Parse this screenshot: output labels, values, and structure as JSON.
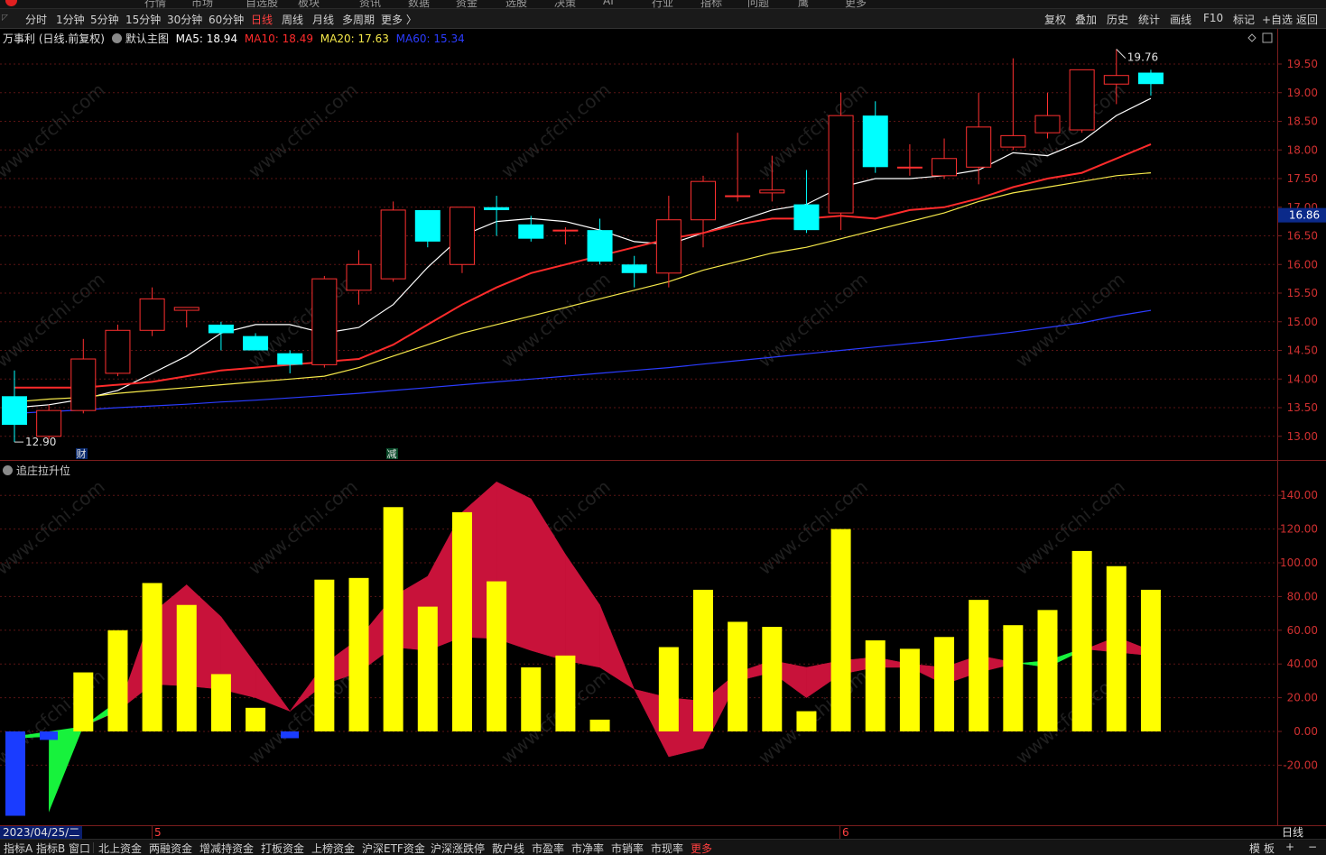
{
  "topstrip": {
    "items": [
      "行情",
      "市场",
      "自选股",
      "板块",
      "资讯",
      "数据",
      "资金",
      "选股",
      "决策",
      "AI",
      "行业",
      "指标",
      "问题",
      "鹰",
      "更多"
    ]
  },
  "periodbar": {
    "periods": [
      "分时",
      "1分钟",
      "5分钟",
      "15分钟",
      "30分钟",
      "60分钟",
      "日线",
      "周线",
      "月线",
      "多周期",
      "更多 〉"
    ],
    "active": "日线",
    "right": [
      "复权",
      "叠加",
      "历史",
      "统计",
      "画线",
      "F10",
      "标记",
      "+自选",
      "返回"
    ]
  },
  "main": {
    "stock": "万事利 (日线.前复权)",
    "template": "默认主图",
    "ma": [
      {
        "label": "MA5: 18.94",
        "color": "#ffffff"
      },
      {
        "label": "MA10: 18.49",
        "color": "#ff2b2b"
      },
      {
        "label": "MA20: 17.63",
        "color": "#f5e84a"
      },
      {
        "label": "MA60: 15.34",
        "color": "#2b3cff"
      }
    ],
    "high_label": "19.76",
    "low_label": "12.90",
    "current_price": "16.86",
    "markers": [
      "财",
      "减"
    ],
    "y_ticks": [
      "19.50",
      "19.00",
      "18.50",
      "18.00",
      "17.50",
      "17.00",
      "16.50",
      "16.00",
      "15.50",
      "15.00",
      "14.50",
      "14.00",
      "13.50",
      "13.00"
    ]
  },
  "sub": {
    "title": "追庄拉升位",
    "y_ticks": [
      "140.00",
      "120.00",
      "100.00",
      "80.00",
      "60.00",
      "40.00",
      "20.00",
      "0.00",
      "-20.00"
    ]
  },
  "datebar": {
    "date": "2023/04/25/二",
    "month_marks": [
      "5",
      "6"
    ],
    "period": "日线"
  },
  "bottom_tabs": [
    "指标A",
    "指标B",
    "窗口",
    "北上资金",
    "两融资金",
    "增减持资金",
    "打板资金",
    "上榜资金",
    "沪深ETF资金",
    "沪深涨跌停",
    "散户线",
    "市盈率",
    "市净率",
    "市销率",
    "市现率",
    "更多"
  ],
  "bottom_right": [
    "模",
    "板",
    "+",
    "−"
  ],
  "watermark": "www.cfchi.com",
  "colors": {
    "up": "#ff3030",
    "down": "#00ffff",
    "ma5": "#ffffff",
    "ma10": "#ff2b2b",
    "ma20": "#f5e84a",
    "ma60": "#2b3cff",
    "bar": "#ffff00",
    "fill_red": "#c8123a",
    "fill_green": "#17f23c",
    "blue": "#1a3cff"
  },
  "chart_data": [
    {
      "type": "candlestick",
      "title": "万事利 (日线.前复权)",
      "ylim": [
        12.6,
        19.9
      ],
      "candles": [
        {
          "o": 13.7,
          "h": 14.15,
          "l": 12.9,
          "c": 13.2
        },
        {
          "o": 13.0,
          "h": 13.55,
          "l": 12.95,
          "c": 13.45
        },
        {
          "o": 13.45,
          "h": 14.7,
          "l": 13.4,
          "c": 14.35
        },
        {
          "o": 14.1,
          "h": 14.95,
          "l": 14.05,
          "c": 14.85
        },
        {
          "o": 14.85,
          "h": 15.6,
          "l": 14.75,
          "c": 15.4
        },
        {
          "o": 15.2,
          "h": 15.25,
          "l": 14.9,
          "c": 15.25
        },
        {
          "o": 14.95,
          "h": 15.0,
          "l": 14.5,
          "c": 14.8
        },
        {
          "o": 14.75,
          "h": 14.8,
          "l": 14.5,
          "c": 14.5
        },
        {
          "o": 14.45,
          "h": 14.5,
          "l": 14.1,
          "c": 14.25
        },
        {
          "o": 14.25,
          "h": 15.8,
          "l": 14.2,
          "c": 15.75
        },
        {
          "o": 15.55,
          "h": 16.25,
          "l": 15.3,
          "c": 16.0
        },
        {
          "o": 15.75,
          "h": 17.1,
          "l": 15.7,
          "c": 16.95
        },
        {
          "o": 16.95,
          "h": 16.95,
          "l": 16.3,
          "c": 16.4
        },
        {
          "o": 16.0,
          "h": 17.0,
          "l": 15.85,
          "c": 17.0
        },
        {
          "o": 17.0,
          "h": 17.2,
          "l": 16.5,
          "c": 16.95
        },
        {
          "o": 16.7,
          "h": 16.85,
          "l": 16.4,
          "c": 16.45
        },
        {
          "o": 16.6,
          "h": 16.65,
          "l": 16.35,
          "c": 16.6
        },
        {
          "o": 16.6,
          "h": 16.8,
          "l": 16.0,
          "c": 16.05
        },
        {
          "o": 16.0,
          "h": 16.15,
          "l": 15.6,
          "c": 15.85
        },
        {
          "o": 15.85,
          "h": 17.2,
          "l": 15.6,
          "c": 16.78
        },
        {
          "o": 16.78,
          "h": 17.55,
          "l": 16.3,
          "c": 17.45
        },
        {
          "o": 17.2,
          "h": 18.3,
          "l": 17.1,
          "c": 17.2
        },
        {
          "o": 17.25,
          "h": 17.9,
          "l": 17.1,
          "c": 17.3
        },
        {
          "o": 17.05,
          "h": 17.65,
          "l": 16.55,
          "c": 16.6
        },
        {
          "o": 16.9,
          "h": 19.0,
          "l": 16.6,
          "c": 18.6
        },
        {
          "o": 18.6,
          "h": 18.85,
          "l": 17.6,
          "c": 17.7
        },
        {
          "o": 17.7,
          "h": 18.1,
          "l": 17.55,
          "c": 17.7
        },
        {
          "o": 17.55,
          "h": 18.2,
          "l": 17.5,
          "c": 17.85
        },
        {
          "o": 17.7,
          "h": 19.0,
          "l": 17.4,
          "c": 18.4
        },
        {
          "o": 18.05,
          "h": 19.6,
          "l": 18.0,
          "c": 18.25
        },
        {
          "o": 18.3,
          "h": 19.0,
          "l": 18.2,
          "c": 18.6
        },
        {
          "o": 18.35,
          "h": 19.4,
          "l": 18.3,
          "c": 19.4
        },
        {
          "o": 19.15,
          "h": 19.76,
          "l": 18.8,
          "c": 19.3
        },
        {
          "o": 19.35,
          "h": 19.4,
          "l": 18.95,
          "c": 19.15
        }
      ],
      "series": [
        {
          "name": "MA5",
          "values": [
            13.5,
            13.55,
            13.65,
            13.8,
            14.1,
            14.4,
            14.8,
            14.95,
            14.95,
            14.8,
            14.9,
            15.3,
            15.95,
            16.5,
            16.75,
            16.8,
            16.75,
            16.6,
            16.4,
            16.35,
            16.55,
            16.75,
            16.95,
            17.05,
            17.35,
            17.5,
            17.5,
            17.55,
            17.65,
            17.95,
            17.9,
            18.15,
            18.6,
            18.9
          ]
        },
        {
          "name": "MA10",
          "values": [
            13.85,
            13.85,
            13.85,
            13.9,
            13.95,
            14.05,
            14.15,
            14.2,
            14.25,
            14.3,
            14.35,
            14.6,
            14.95,
            15.3,
            15.6,
            15.85,
            16.0,
            16.15,
            16.3,
            16.45,
            16.55,
            16.7,
            16.8,
            16.8,
            16.85,
            16.8,
            16.95,
            17.0,
            17.15,
            17.35,
            17.5,
            17.6,
            17.85,
            18.1
          ]
        },
        {
          "name": "MA20",
          "values": [
            13.6,
            13.65,
            13.68,
            13.75,
            13.8,
            13.85,
            13.9,
            13.95,
            14.0,
            14.05,
            14.2,
            14.4,
            14.6,
            14.8,
            14.95,
            15.1,
            15.25,
            15.4,
            15.55,
            15.7,
            15.9,
            16.05,
            16.2,
            16.3,
            16.45,
            16.6,
            16.75,
            16.9,
            17.1,
            17.25,
            17.35,
            17.45,
            17.55,
            17.6
          ]
        },
        {
          "name": "MA60",
          "values": [
            13.4,
            13.43,
            13.46,
            13.5,
            13.53,
            13.56,
            13.6,
            13.63,
            13.67,
            13.71,
            13.75,
            13.8,
            13.85,
            13.9,
            13.95,
            14.0,
            14.05,
            14.1,
            14.15,
            14.2,
            14.26,
            14.32,
            14.38,
            14.44,
            14.5,
            14.56,
            14.62,
            14.68,
            14.75,
            14.82,
            14.9,
            14.98,
            15.1,
            15.2
          ]
        }
      ]
    },
    {
      "type": "bar",
      "title": "追庄拉升位",
      "ylim": [
        -30,
        150
      ],
      "bars": [
        -30,
        -3,
        35,
        60,
        88,
        75,
        34,
        14,
        -4,
        90,
        91,
        133,
        74,
        130,
        89,
        38,
        45,
        7,
        0,
        50,
        84,
        65,
        62,
        12,
        120,
        54,
        49,
        56,
        78,
        63,
        72,
        107,
        98,
        84
      ],
      "upper": [
        -4,
        -3,
        3,
        12,
        70,
        87,
        68,
        40,
        12,
        40,
        55,
        80,
        92,
        130,
        148,
        138,
        105,
        75,
        25,
        20,
        18,
        35,
        42,
        38,
        42,
        44,
        40,
        38,
        45,
        41,
        38,
        48,
        56,
        48
      ],
      "lower": [
        -3,
        -3,
        3,
        12,
        28,
        27,
        25,
        20,
        12,
        28,
        35,
        50,
        48,
        56,
        55,
        48,
        42,
        38,
        25,
        -15,
        -10,
        30,
        35,
        20,
        34,
        38,
        38,
        28,
        35,
        40,
        42,
        49,
        47,
        45
      ]
    }
  ]
}
